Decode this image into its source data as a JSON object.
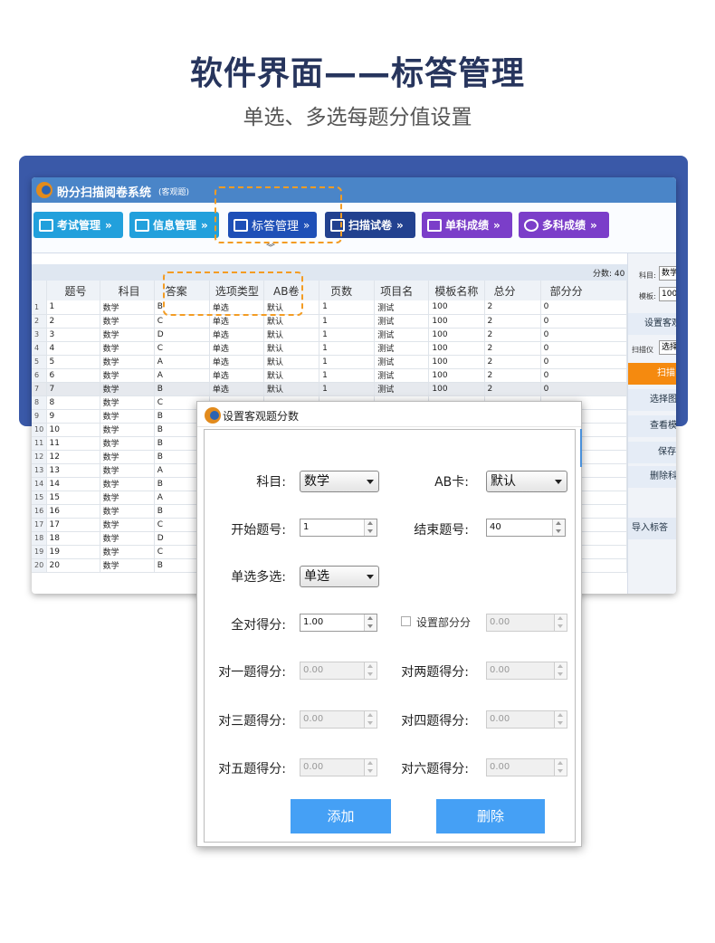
{
  "hero": {
    "title": "软件界面——标答管理",
    "subtitle": "单选、多选每题分值设置"
  },
  "app": {
    "title": "盼分扫描阅卷系统",
    "subtitle": "(客观题)",
    "nav": [
      "考试管理",
      "信息管理",
      "标答管理",
      "扫描试卷",
      "单科成绩",
      "多科成绩"
    ],
    "score_total": "分数: 40",
    "columns": [
      "题号",
      "科目",
      "答案",
      "选项类型",
      "AB卷",
      "页数",
      "项目名",
      "模板名称",
      "总分",
      "部分分"
    ],
    "rows": [
      [
        "1",
        "1",
        "数学",
        "B",
        "单选",
        "默认",
        "1",
        "测试",
        "100",
        "2",
        "0"
      ],
      [
        "2",
        "2",
        "数学",
        "C",
        "单选",
        "默认",
        "1",
        "测试",
        "100",
        "2",
        "0"
      ],
      [
        "3",
        "3",
        "数学",
        "D",
        "单选",
        "默认",
        "1",
        "测试",
        "100",
        "2",
        "0"
      ],
      [
        "4",
        "4",
        "数学",
        "C",
        "单选",
        "默认",
        "1",
        "测试",
        "100",
        "2",
        "0"
      ],
      [
        "5",
        "5",
        "数学",
        "A",
        "单选",
        "默认",
        "1",
        "测试",
        "100",
        "2",
        "0"
      ],
      [
        "6",
        "6",
        "数学",
        "A",
        "单选",
        "默认",
        "1",
        "测试",
        "100",
        "2",
        "0"
      ],
      [
        "7",
        "7",
        "数学",
        "B",
        "单选",
        "默认",
        "1",
        "测试",
        "100",
        "2",
        "0"
      ],
      [
        "8",
        "8",
        "数学",
        "C",
        "",
        "",
        "",
        "",
        "",
        "",
        ""
      ],
      [
        "9",
        "9",
        "数学",
        "B",
        "",
        "",
        "",
        "",
        "",
        "",
        ""
      ],
      [
        "10",
        "10",
        "数学",
        "B",
        "",
        "",
        "",
        "",
        "",
        "",
        ""
      ],
      [
        "11",
        "11",
        "数学",
        "B",
        "",
        "",
        "",
        "",
        "",
        "",
        ""
      ],
      [
        "12",
        "12",
        "数学",
        "B",
        "",
        "",
        "",
        "",
        "",
        "",
        ""
      ],
      [
        "13",
        "13",
        "数学",
        "A",
        "",
        "",
        "",
        "",
        "",
        "",
        ""
      ],
      [
        "14",
        "14",
        "数学",
        "B",
        "",
        "",
        "",
        "",
        "",
        "",
        ""
      ],
      [
        "15",
        "15",
        "数学",
        "A",
        "",
        "",
        "",
        "",
        "",
        "",
        ""
      ],
      [
        "16",
        "16",
        "数学",
        "B",
        "",
        "",
        "",
        "",
        "",
        "",
        ""
      ],
      [
        "17",
        "17",
        "数学",
        "C",
        "",
        "",
        "",
        "",
        "",
        "",
        ""
      ],
      [
        "18",
        "18",
        "数学",
        "D",
        "",
        "",
        "",
        "",
        "",
        "",
        ""
      ],
      [
        "19",
        "19",
        "数学",
        "C",
        "",
        "",
        "",
        "",
        "",
        "",
        ""
      ],
      [
        "20",
        "20",
        "数学",
        "B",
        "",
        "",
        "",
        "",
        "",
        "",
        ""
      ]
    ],
    "right": {
      "subject_label": "科目:",
      "subject_value": "数学",
      "template_label": "模板:",
      "template_value": "100",
      "set_btn": "设置客观",
      "scanner_label": "扫描仪",
      "scanner_value": "选择",
      "scan_btn": "扫描",
      "select_img_btn": "选择图",
      "view_btn": "查看模",
      "save_btn": "保存",
      "delete_btn": "删除科",
      "import_btn": "导入标答"
    }
  },
  "dialog": {
    "title": "设置客观题分数",
    "subject_label": "科目:",
    "subject_value": "数学",
    "ab_label": "AB卡:",
    "ab_value": "默认",
    "start_label": "开始题号:",
    "start_value": "1",
    "end_label": "结束题号:",
    "end_value": "40",
    "type_label": "单选多选:",
    "type_value": "单选",
    "full_label": "全对得分:",
    "full_value": "1.00",
    "partial_label": "设置部分分",
    "partial_value": "0.00",
    "one_label": "对一题得分:",
    "one_value": "0.00",
    "two_label": "对两题得分:",
    "two_value": "0.00",
    "three_label": "对三题得分:",
    "three_value": "0.00",
    "four_label": "对四题得分:",
    "four_value": "0.00",
    "five_label": "对五题得分:",
    "five_value": "0.00",
    "six_label": "对六题得分:",
    "six_value": "0.00",
    "add_btn": "添加",
    "delete_btn": "删除"
  }
}
